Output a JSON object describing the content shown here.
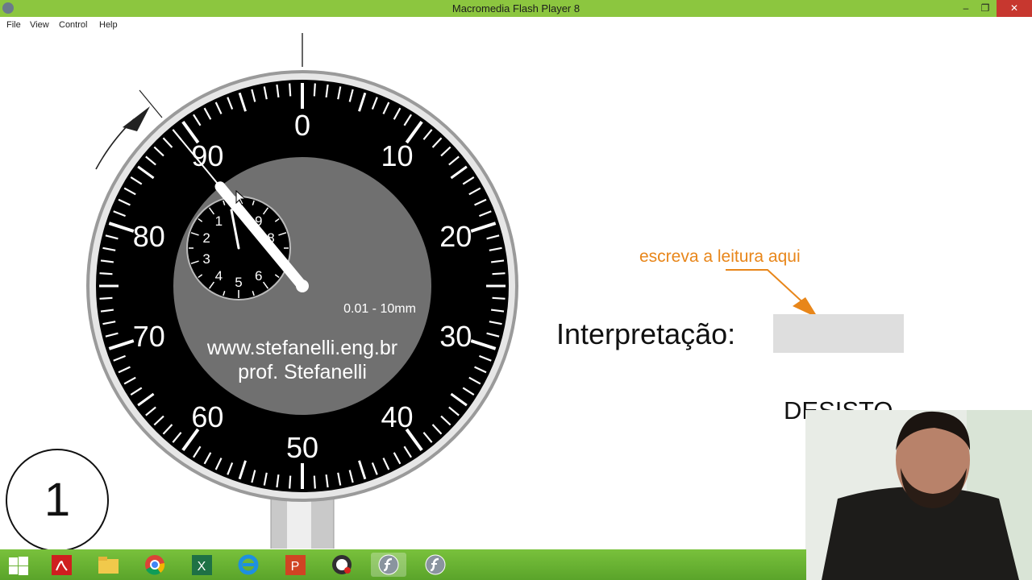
{
  "window": {
    "title": "Macromedia Flash Player 8",
    "controls": {
      "minimize": "–",
      "restore": "❐",
      "close": "✕"
    }
  },
  "menu": [
    "File",
    "View",
    "Control",
    "Help"
  ],
  "gauge": {
    "main_numbers": [
      "0",
      "10",
      "20",
      "30",
      "40",
      "50",
      "60",
      "70",
      "80",
      "90"
    ],
    "small_numbers": [
      "9",
      "8",
      "6",
      "5",
      "4",
      "3",
      "2",
      "1"
    ],
    "range_label": "0.01 - 10mm",
    "website": "www.stefanelli.eng.br",
    "author": "prof. Stefanelli",
    "main_pointer_value": 89,
    "small_pointer_value": 0.3
  },
  "hint_text": "escreva a leitura aqui",
  "interpretation_label": "Interpretação:",
  "answer_value": "",
  "give_up_label": "DESISTO",
  "step_number": "1",
  "colors": {
    "titlebar": "#8cc63f",
    "accent": "#e8861a",
    "taskbar": "#5aa42a"
  },
  "taskbar": {
    "items": [
      {
        "icon": "windows-start-icon",
        "active": false
      },
      {
        "icon": "acrobat-icon",
        "active": false
      },
      {
        "icon": "file-explorer-icon",
        "active": false
      },
      {
        "icon": "chrome-icon",
        "active": false
      },
      {
        "icon": "excel-icon",
        "active": false
      },
      {
        "icon": "internet-explorer-icon",
        "active": false
      },
      {
        "icon": "powerpoint-icon",
        "active": false
      },
      {
        "icon": "obs-icon",
        "active": false
      },
      {
        "icon": "flash-player-icon",
        "active": true
      },
      {
        "icon": "flash-player-icon",
        "active": false
      }
    ]
  }
}
